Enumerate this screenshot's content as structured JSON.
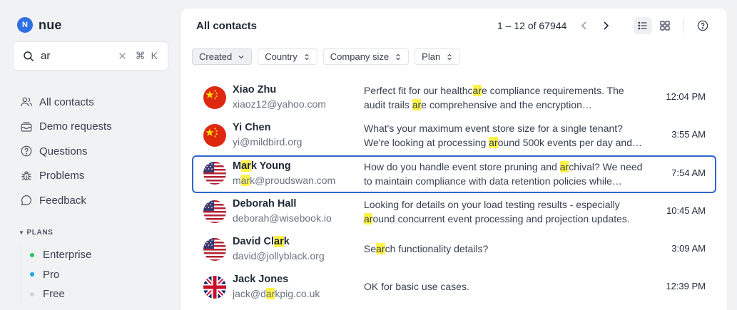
{
  "app": {
    "logo_letter": "N",
    "name": "nue"
  },
  "search": {
    "value": "ar",
    "clear": "✕",
    "shortcut": "⌘ K"
  },
  "nav": [
    {
      "label": "All contacts",
      "icon": "users-icon"
    },
    {
      "label": "Demo requests",
      "icon": "inbox-icon"
    },
    {
      "label": "Questions",
      "icon": "question-icon"
    },
    {
      "label": "Problems",
      "icon": "bug-icon"
    },
    {
      "label": "Feedback",
      "icon": "chat-icon"
    }
  ],
  "plans": {
    "title": "PLANS",
    "items": [
      {
        "label": "Enterprise",
        "color": "#22c55e"
      },
      {
        "label": "Pro",
        "color": "#0ea5e9"
      },
      {
        "label": "Free",
        "color": "#d1d5db"
      }
    ]
  },
  "main": {
    "title": "All contacts",
    "pager": "1 – 12 of 67944"
  },
  "filters": [
    "Created",
    "Country",
    "Company size",
    "Plan"
  ],
  "highlight": "ar",
  "rows": [
    {
      "name": "Xiao Zhu",
      "email": "xiaoz12@yahoo.com",
      "flag": "cn",
      "message": "Perfect fit for our healthcare compliance requirements. The audit trails are comprehensive and the encryption…",
      "time": "12:04 PM"
    },
    {
      "name": "Yi Chen",
      "email": "yi@mildbird.org",
      "flag": "cn",
      "message": "What's your maximum event store size for a single tenant? We're looking at processing around 500k events per day and…",
      "time": "3:55 AM"
    },
    {
      "name": "Mark Young",
      "email": "mark@proudswan.com",
      "flag": "us",
      "selected": true,
      "message": "How do you handle event store pruning and archival? We need to maintain compliance with data retention policies while…",
      "time": "7:54 AM"
    },
    {
      "name": "Deborah Hall",
      "email": "deborah@wisebook.io",
      "flag": "us",
      "message": "Looking for details on your load testing results - especially around concurrent event processing and projection updates.",
      "time": "10:45 AM"
    },
    {
      "name": "David Clark",
      "email": "david@jollyblack.org",
      "flag": "us",
      "message": "Search functionality details?",
      "time": "3:09 AM"
    },
    {
      "name": "Jack Jones",
      "email": "jack@darkpig.co.uk",
      "flag": "uk",
      "message": "OK for basic use cases.",
      "time": "12:39 PM"
    }
  ]
}
